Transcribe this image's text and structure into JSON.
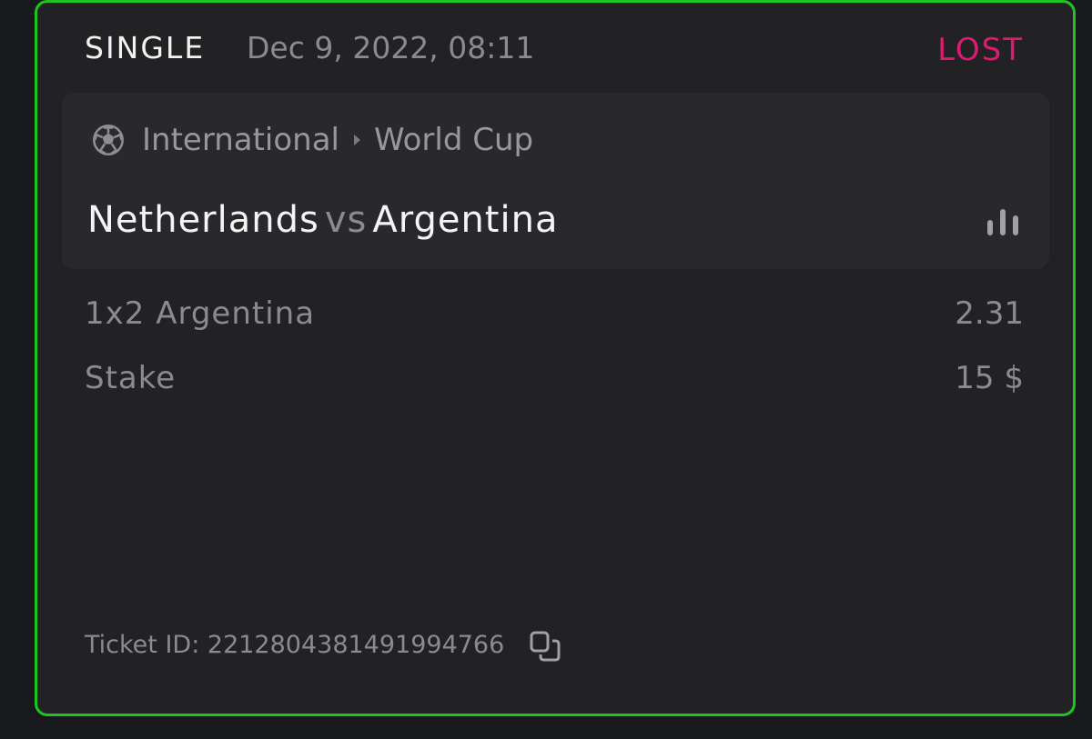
{
  "bet": {
    "type": "SINGLE",
    "date": "Dec 9, 2022, 08:11",
    "status": "LOST",
    "status_color": "#e1186f",
    "border_color": "#1ec51e"
  },
  "event": {
    "sport_icon": "soccer-ball-icon",
    "region": "International",
    "league": "World Cup",
    "home_team": "Netherlands",
    "vs": "vs",
    "away_team": "Argentina",
    "stats_icon": "bar-chart-icon"
  },
  "selection": {
    "market": "1x2 Argentina",
    "odds": "2.31"
  },
  "stake": {
    "label": "Stake",
    "value": "15 $"
  },
  "ticket": {
    "label": "Ticket ID: 2212804381491994766",
    "copy_icon": "copy-icon"
  }
}
